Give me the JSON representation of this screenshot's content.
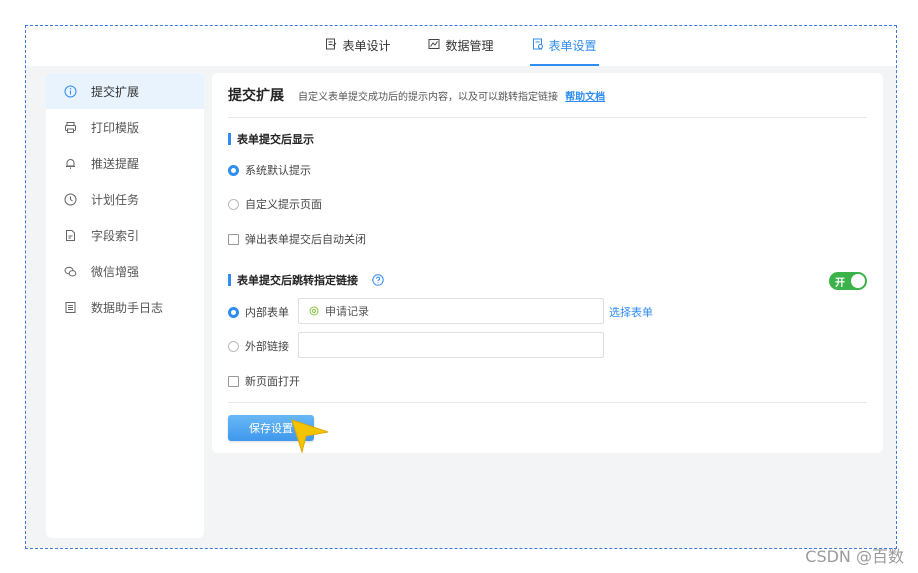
{
  "topnav": {
    "tabs": [
      {
        "label": "表单设计",
        "icon": "form-design-icon",
        "active": false
      },
      {
        "label": "数据管理",
        "icon": "chart-icon",
        "active": false
      },
      {
        "label": "表单设置",
        "icon": "form-settings-icon",
        "active": true
      }
    ]
  },
  "sidebar": {
    "items": [
      {
        "label": "提交扩展",
        "icon": "info-circle-icon",
        "active": true
      },
      {
        "label": "打印模版",
        "icon": "printer-icon",
        "active": false
      },
      {
        "label": "推送提醒",
        "icon": "bell-icon",
        "active": false
      },
      {
        "label": "计划任务",
        "icon": "clock-icon",
        "active": false
      },
      {
        "label": "字段索引",
        "icon": "document-icon",
        "active": false
      },
      {
        "label": "微信增强",
        "icon": "wechat-icon",
        "active": false
      },
      {
        "label": "数据助手日志",
        "icon": "list-doc-icon",
        "active": false
      }
    ]
  },
  "panel": {
    "title": "提交扩展",
    "description": "自定义表单提交成功后的提示内容，以及可以跳转指定链接",
    "help_link": "帮助文档",
    "section1": {
      "title": "表单提交后显示",
      "option_default": "系统默认提示",
      "option_custom": "自定义提示页面",
      "auto_close": "弹出表单提交后自动关闭",
      "selected": "系统默认提示"
    },
    "section2": {
      "title": "表单提交后跳转指定链接",
      "toggle_label": "开",
      "toggle_on": true,
      "option_internal": "内部表单",
      "internal_value": "申请记录",
      "select_form_link": "选择表单",
      "option_external": "外部链接",
      "external_value": "",
      "new_page": "新页面打开",
      "selected": "内部表单"
    },
    "save_label": "保存设置"
  },
  "colors": {
    "accent": "#2f8cf0",
    "toggle_on": "#3cb34a",
    "frame_border": "#3b7ad9"
  },
  "watermark": "CSDN @百数"
}
